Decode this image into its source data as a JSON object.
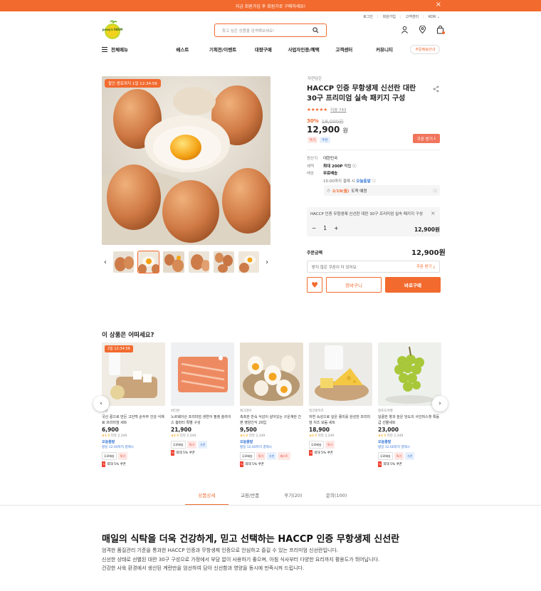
{
  "banner": {
    "text": "지금 회원가입 후 회원가로 구매하세요!"
  },
  "util": {
    "login": "로그인",
    "join": "회원가입",
    "cs": "고객센터",
    "lang": "KOR"
  },
  "logo": {
    "text": "pooq's FARM"
  },
  "search": {
    "placeholder": "찾고 싶은 상품을 검색해보세요!"
  },
  "nav": {
    "all": "전체메뉴",
    "items": [
      "베스트",
      "기획전/이벤트",
      "대량구매",
      "사업자인증/혜택",
      "고객센터",
      "커뮤니티"
    ],
    "pill": "주문배송안내"
  },
  "product": {
    "timer": "할인 종료까지 1일 12:34:56",
    "brand": "자연담은",
    "title": "HACCP 인증 무항생제 신선란 대란 30구 프리미엄 실속 패키지 구성",
    "stars": "★★★★★",
    "reviews": "리뷰 743",
    "discount": "30%",
    "original": "18,000원",
    "price": "12,900",
    "won": "원",
    "coupon_btn": "쿠폰 받기",
    "tags": [
      "특가",
      "추천"
    ],
    "origin_label": "원산지",
    "origin": "대한민국",
    "benefit_label": "혜택",
    "benefit": "최대 200P",
    "benefit_suffix": "적립",
    "ship_label": "배송",
    "ship": "무료배송",
    "ship_note": "15:00까지 결제 시",
    "ship_badge": "오늘출발",
    "arrival_date": "2/19(월)",
    "arrival_text": "도착 예정",
    "option_name": "HACCP 인증 무항생제 신선란 대란 30구 프리미엄 실속 패키지 구성",
    "qty": "1",
    "option_price": "12,900원",
    "total_label": "주문금액",
    "total": "12,900원",
    "coupon_note": "받지 않은 쿠폰이 더 있어요",
    "coupon_link": "쿠폰 받기",
    "cart": "장바구니",
    "buy": "바로구매"
  },
  "recommend": {
    "title": "이 상품은 어떠세요?",
    "items": [
      {
        "timer": "2일 12:34:56",
        "brand": "콩담",
        "name": "국산 콩으로 만든 고단백 순두부 건강 식재료 프리미엄 세트",
        "price": "6,900",
        "rating": "★4.9",
        "reviews": "리뷰 2,349",
        "go": "오늘출발",
        "date": "평일 12:00까지 결제시",
        "tags": [
          "무료배송",
          "특가"
        ],
        "bonus": "최대 5% 쿠폰"
      },
      {
        "timer": "",
        "brand": "바다온",
        "name": "노르웨이산 프리미엄 생연어 필렛 슬라이스 홈파티 특별 구성",
        "price": "21,900",
        "rating": "★4.9",
        "reviews": "리뷰 2,349",
        "go": "",
        "date": "",
        "tags": [
          "무료배송",
          "특가",
          "추천"
        ],
        "bonus": "최대 5% 쿠폰"
      },
      {
        "timer": "",
        "brand": "에그데이",
        "name": "촉촉한 반숙 식감이 살아있는 구운계란 간편 영양간식 20입",
        "price": "9,500",
        "rating": "★4.9",
        "reviews": "리뷰 2,349",
        "go": "오늘출발",
        "date": "평일 12:00까지 결제시",
        "tags": [
          "무료배송",
          "특가",
          "추천",
          "베스트"
        ],
        "bonus": "최대 5% 쿠폰"
      },
      {
        "timer": "",
        "brand": "밀크앤치즈",
        "name": "자연 숙성으로 깊은 풍미를 완성한 프리미엄 치즈 모둠 세트",
        "price": "18,900",
        "rating": "★4.9",
        "reviews": "리뷰 2,349",
        "go": "",
        "date": "",
        "tags": [
          "무료배송",
          "특가"
        ],
        "bonus": "최대 5% 쿠폰"
      },
      {
        "timer": "",
        "brand": "청포도마켓",
        "name": "달콤한 향과 높은 당도의 샤인머스캣 특등급 선물세트",
        "price": "23,000",
        "rating": "★4.9",
        "reviews": "리뷰 2,349",
        "go": "오늘출발",
        "date": "평일 12:00까지 결제시",
        "tags": [
          "무료배송",
          "특가",
          "추천"
        ],
        "bonus": "최대 5% 쿠폰"
      }
    ]
  },
  "tabs": [
    "상품상세",
    "교환/반품",
    "후기(20)",
    "문의(100)"
  ],
  "detail": {
    "title": "매일의 식탁을 더욱 건강하게, 믿고 선택하는 HACCP 인증 무항생제 신선란",
    "lines": [
      "엄격한 품질관리 기준을 통과한 HACCP 인증과 무항생제 인증으로 안심하고 즐길 수 있는 프리미엄 신선란입니다.",
      "신선한 상태로 선별된 대란 30구 구성으로 가정에서 부담 없이 사용하기 좋으며, 아침 식사부터 다양한 요리까지 활용도가 뛰어납니다.",
      "건강한 사육 환경에서 생산된 계란만을 엄선하여 담아 신선함과 영양을 동시에 만족시켜 드립니다."
    ]
  },
  "colors": {
    "accent": "#f26a2e",
    "blue": "#3a78d8"
  }
}
